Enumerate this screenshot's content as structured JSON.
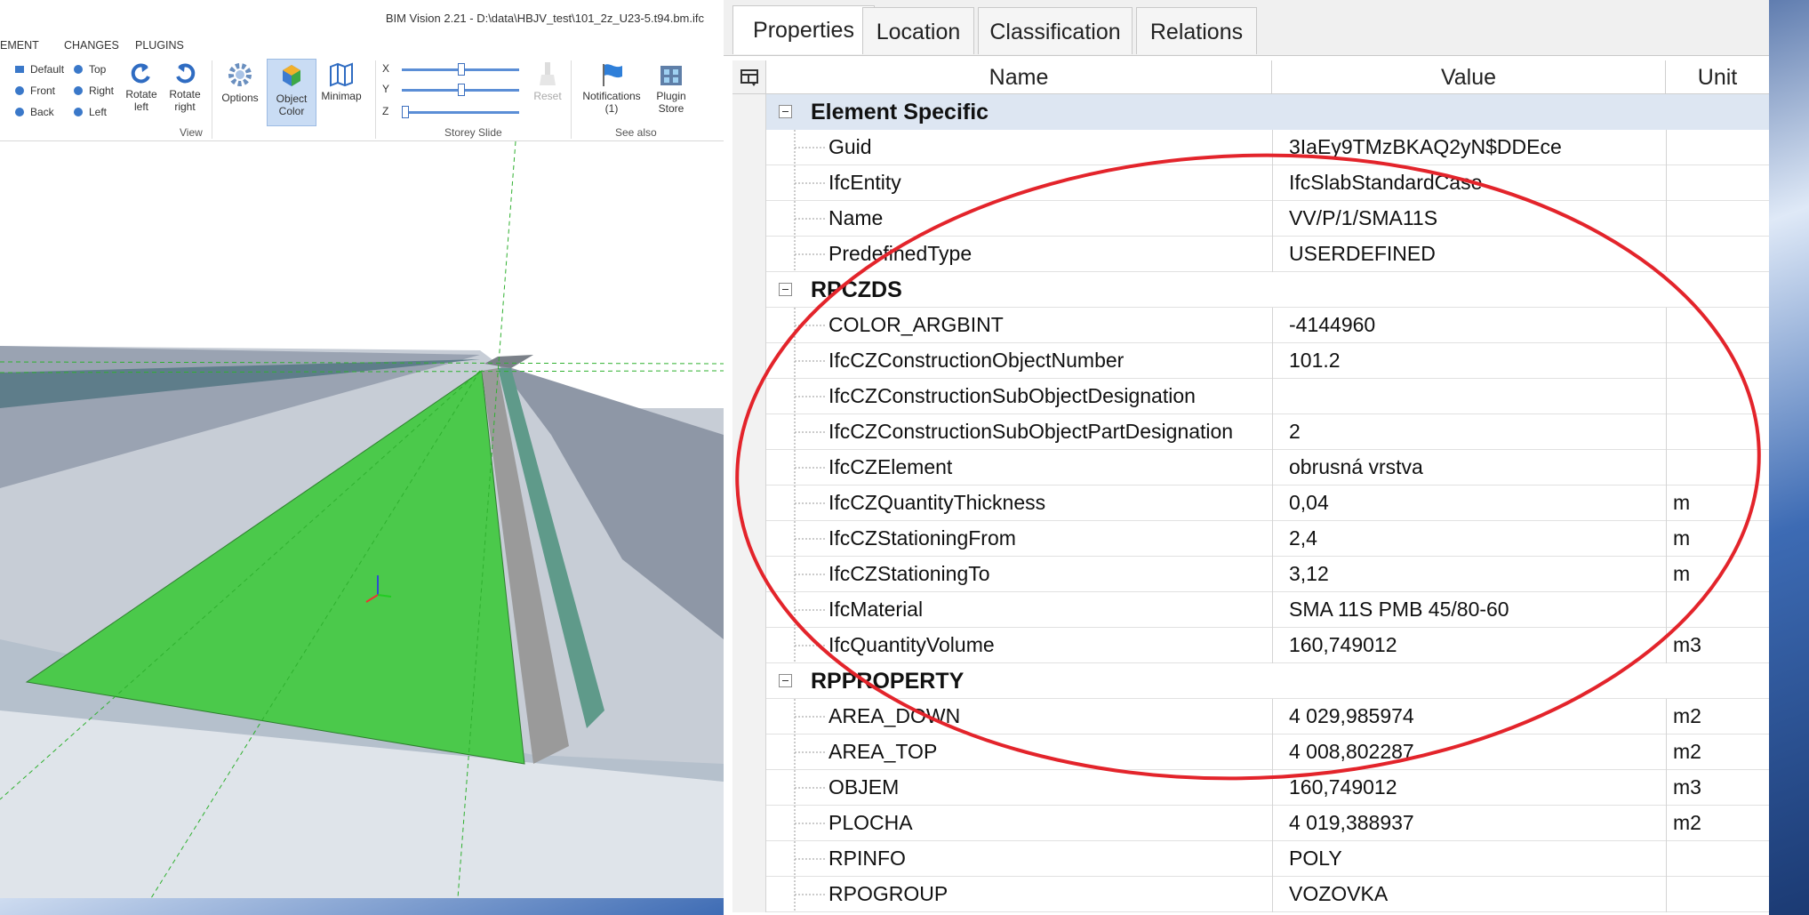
{
  "window": {
    "title": "BIM Vision 2.21 - D:\\data\\HBJV_test\\101_2z_U23-5.t94.bm.ifc"
  },
  "menu": [
    "EMENT",
    "CHANGES",
    "PLUGINS"
  ],
  "ribbon": {
    "view_buttons": [
      "Default",
      "Top",
      "Front",
      "Right",
      "Back",
      "Left"
    ],
    "rotate_left": "Rotate left",
    "rotate_right": "Rotate right",
    "options": "Options",
    "object_color": "Object Color",
    "minimap": "Minimap",
    "view_group": "View",
    "axes": [
      "X",
      "Y",
      "Z"
    ],
    "reset": "Reset",
    "storey_group": "Storey Slide",
    "notifications": "Notifications (1)",
    "plugin_store": "Plugin Store",
    "see_also_group": "See also"
  },
  "tabs": [
    "Properties",
    "Location",
    "Classification",
    "Relations"
  ],
  "columns": {
    "name": "Name",
    "value": "Value",
    "unit": "Unit"
  },
  "rows": [
    {
      "type": "category",
      "label": "Element Specific"
    },
    {
      "type": "prop",
      "name": "Guid",
      "value": "3IaEy9TMzBKAQ2yN$DDEce",
      "unit": ""
    },
    {
      "type": "prop",
      "name": "IfcEntity",
      "value": "IfcSlabStandardCase",
      "unit": ""
    },
    {
      "type": "prop",
      "name": "Name",
      "value": "VV/P/1/SMA11S",
      "unit": ""
    },
    {
      "type": "prop",
      "name": "PredefinedType",
      "value": "USERDEFINED",
      "unit": ""
    },
    {
      "type": "category",
      "label": "RPCZDS"
    },
    {
      "type": "prop",
      "name": "COLOR_ARGBINT",
      "value": "-4144960",
      "unit": ""
    },
    {
      "type": "prop",
      "name": "IfcCZConstructionObjectNumber",
      "value": "101.2",
      "unit": ""
    },
    {
      "type": "prop",
      "name": "IfcCZConstructionSubObjectDesignation",
      "value": "",
      "unit": ""
    },
    {
      "type": "prop",
      "name": "IfcCZConstructionSubObjectPartDesignation",
      "value": "2",
      "unit": ""
    },
    {
      "type": "prop",
      "name": "IfcCZElement",
      "value": "obrusná vrstva",
      "unit": ""
    },
    {
      "type": "prop",
      "name": "IfcCZQuantityThickness",
      "value": "0,04",
      "unit": "m"
    },
    {
      "type": "prop",
      "name": "IfcCZStationingFrom",
      "value": "2,4",
      "unit": "m"
    },
    {
      "type": "prop",
      "name": "IfcCZStationingTo",
      "value": "3,12",
      "unit": "m"
    },
    {
      "type": "prop",
      "name": "IfcMaterial",
      "value": "SMA 11S  PMB 45/80-60",
      "unit": ""
    },
    {
      "type": "prop",
      "name": "IfcQuantityVolume",
      "value": "160,749012",
      "unit": "m3"
    },
    {
      "type": "category",
      "label": "RPPROPERTY"
    },
    {
      "type": "prop",
      "name": "AREA_DOWN",
      "value": "4 029,985974",
      "unit": "m2"
    },
    {
      "type": "prop",
      "name": "AREA_TOP",
      "value": "4 008,802287",
      "unit": "m2"
    },
    {
      "type": "prop",
      "name": "OBJEM",
      "value": "160,749012",
      "unit": "m3"
    },
    {
      "type": "prop",
      "name": "PLOCHA",
      "value": "4 019,388937",
      "unit": "m2"
    },
    {
      "type": "prop",
      "name": "RPINFO",
      "value": "POLY",
      "unit": ""
    },
    {
      "type": "prop",
      "name": "RPOGROUP",
      "value": "VOZOVKA",
      "unit": ""
    }
  ],
  "colors": {
    "selection": "#4bc94b",
    "annotation": "#e3242b",
    "category_band": "#dde6f2"
  }
}
